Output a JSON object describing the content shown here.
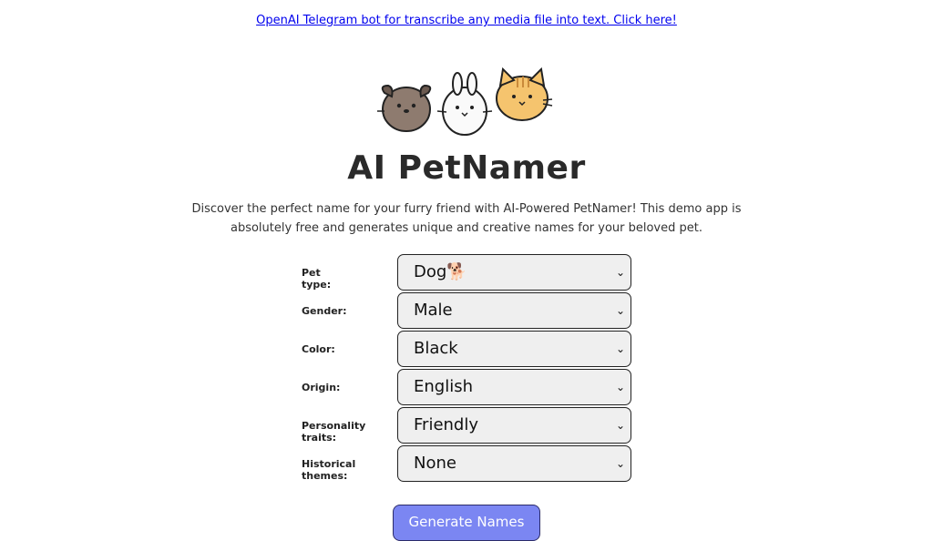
{
  "promo_link": "OpenAI Telegram bot for transcribe any media file into text. Click here!",
  "title": "AI PetNamer",
  "description": "Discover the perfect name for your furry friend with AI-Powered PetNamer! This demo app is absolutely free and generates unique and creative names for your beloved pet.",
  "form": {
    "pet_type": {
      "label": "Pet type:",
      "value": "Dog🐕"
    },
    "gender": {
      "label": "Gender:",
      "value": "Male"
    },
    "color": {
      "label": "Color:",
      "value": "Black"
    },
    "origin": {
      "label": "Origin:",
      "value": "English"
    },
    "personality": {
      "label": "Personality traits:",
      "value": "Friendly"
    },
    "historical": {
      "label": "Historical themes:",
      "value": "None"
    }
  },
  "generate_label": "Generate Names",
  "colors": {
    "button_bg": "#7b86f2",
    "select_bg": "#efefef",
    "link": "#0000ee"
  },
  "icons": [
    "dog-mascot",
    "rabbit-mascot",
    "cat-mascot",
    "chevron-down-icon"
  ]
}
